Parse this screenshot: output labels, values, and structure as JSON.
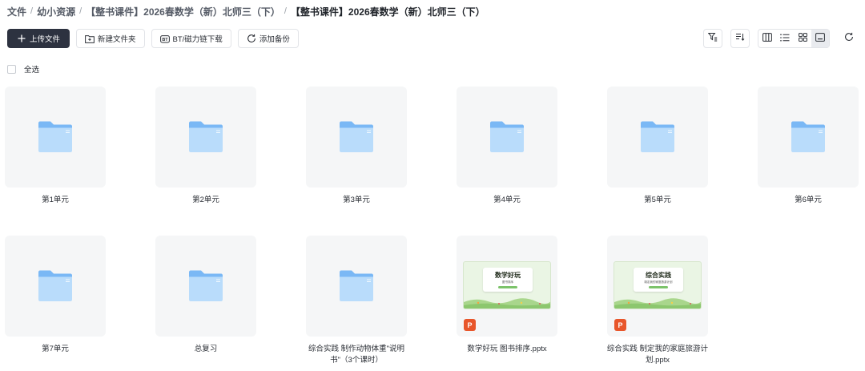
{
  "breadcrumb": [
    {
      "label": "文件"
    },
    {
      "label": "幼小资源"
    },
    {
      "label": "【整书课件】2026春数学（新）北师三（下）"
    },
    {
      "label": "【整书课件】2026春数学（新）北师三（下）"
    }
  ],
  "toolbar": {
    "upload_label": "上传文件",
    "new_folder_label": "新建文件夹",
    "bt_download_label": "BT/磁力链下载",
    "add_backup_label": "添加备份"
  },
  "select_all_label": "全选",
  "items": [
    {
      "type": "folder",
      "name": "第1单元"
    },
    {
      "type": "folder",
      "name": "第2单元"
    },
    {
      "type": "folder",
      "name": "第3单元"
    },
    {
      "type": "folder",
      "name": "第4单元"
    },
    {
      "type": "folder",
      "name": "第5单元"
    },
    {
      "type": "folder",
      "name": "第6单元"
    },
    {
      "type": "folder",
      "name": "第7单元"
    },
    {
      "type": "folder",
      "name": "总复习"
    },
    {
      "type": "folder",
      "name": "综合实践 制作动物体重\"说明书\"（3个课时）"
    },
    {
      "type": "pptx",
      "name": "数学好玩 图书排序.pptx",
      "slide_title": "数学好玩",
      "slide_subtitle": "图书排序"
    },
    {
      "type": "pptx",
      "name": "综合实践 制定我的家庭旅游计划.pptx",
      "slide_title": "综合实践",
      "slide_subtitle": "制定我的家庭旅游计划"
    }
  ],
  "file_badge": "P",
  "colors": {
    "primary_button": "#2d3240",
    "folder_light": "#b9dcfb",
    "folder_dark": "#7ab8f5",
    "ppt_badge": "#e8562b",
    "slide_bg": "#eaf5e4"
  }
}
